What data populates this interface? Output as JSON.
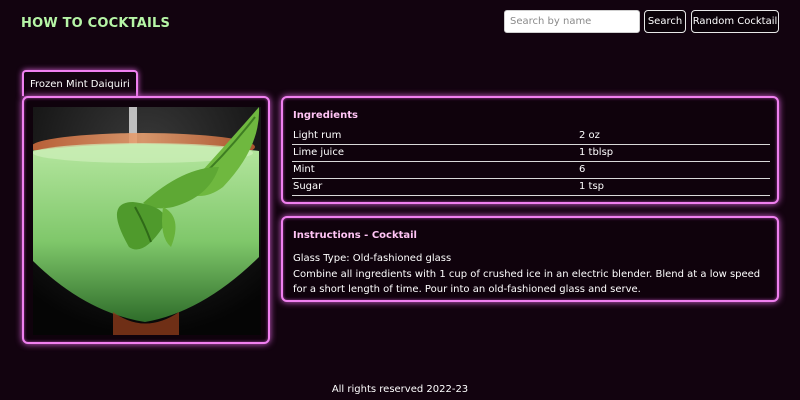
{
  "header": {
    "brand": "HOW TO COCKTAILS",
    "search_placeholder": "Search by name",
    "search_label": "Search",
    "random_label": "Random Cocktail"
  },
  "cocktail": {
    "name": "Frozen Mint Daiquiri",
    "ingredients_title": "Ingredients",
    "ingredients": [
      {
        "name": "Light rum",
        "measure": "2 oz"
      },
      {
        "name": "Lime juice",
        "measure": "1 tblsp"
      },
      {
        "name": "Mint",
        "measure": "6"
      },
      {
        "name": "Sugar",
        "measure": "1 tsp"
      }
    ],
    "instructions_title": "Instructions - Cocktail",
    "glass": "Glass Type: Old-fashioned glass",
    "instructions": "Combine all ingredients with 1 cup of crushed ice in an electric blender. Blend at a low speed for a short length of time. Pour into an old-fashioned glass and serve."
  },
  "footer": {
    "text": "All rights reserved 2022-23"
  },
  "colors": {
    "background": "#12030f",
    "brand": "#b6f5a6",
    "neon_border": "#f080f0",
    "panel_title": "#ffc4f5"
  }
}
